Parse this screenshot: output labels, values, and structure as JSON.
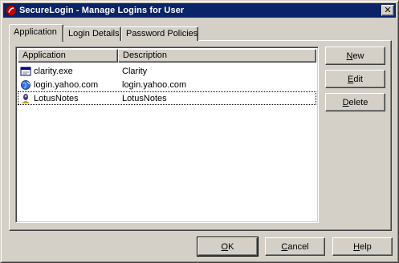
{
  "window": {
    "title": "SecureLogin - Manage Logins for User",
    "close_label": "✕"
  },
  "tabs": [
    {
      "label": "Application",
      "active": true
    },
    {
      "label": "Login Details",
      "active": false
    },
    {
      "label": "Password Policies",
      "active": false
    }
  ],
  "list": {
    "columns": [
      "Application",
      "Description"
    ],
    "rows": [
      {
        "application": "clarity.exe",
        "description": "Clarity",
        "icon": "window-app-icon"
      },
      {
        "application": "login.yahoo.com",
        "description": "login.yahoo.com",
        "icon": "web-globe-icon"
      },
      {
        "application": "LotusNotes",
        "description": "LotusNotes",
        "icon": "lotus-notes-icon"
      }
    ]
  },
  "side_buttons": {
    "new": {
      "accel": "N",
      "rest": "ew"
    },
    "edit": {
      "accel": "E",
      "rest": "dit"
    },
    "delete": {
      "accel": "D",
      "rest": "elete"
    }
  },
  "footer_buttons": {
    "ok": {
      "accel": "O",
      "rest": "K"
    },
    "cancel": {
      "accel": "C",
      "rest": "ancel"
    },
    "help": {
      "accel": "H",
      "rest": "elp"
    }
  },
  "colors": {
    "titlebar": "#0a246a",
    "face": "#d4d0c8"
  }
}
